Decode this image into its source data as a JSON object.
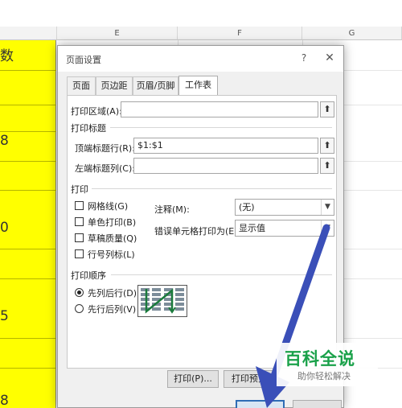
{
  "spreadsheet": {
    "columns": [
      "E",
      "F",
      "G"
    ],
    "yellow_cells": [
      "数",
      "8",
      "0",
      "5",
      "8"
    ]
  },
  "dialog": {
    "title": "页面设置",
    "help": "?",
    "close": "✕",
    "tabs": [
      "页面",
      "页边距",
      "页眉/页脚",
      "工作表"
    ],
    "active_tab": "工作表",
    "print_area": {
      "label": "打印区域(A):",
      "value": ""
    },
    "print_titles": {
      "section": "打印标题",
      "rows_label": "顶端标题行(R):",
      "rows_value": "$1:$1",
      "cols_label": "左端标题列(C):",
      "cols_value": ""
    },
    "print": {
      "section": "打印",
      "gridlines": "网格线(G)",
      "black_white": "单色打印(B)",
      "draft": "草稿质量(Q)",
      "row_col_headings": "行号列标(L)",
      "comments_label": "注释(M):",
      "comments_value": "(无)",
      "errors_label": "错误单元格打印为(E):",
      "errors_value": "显示值"
    },
    "page_order": {
      "section": "打印顺序",
      "down_then_over": "先列后行(D)",
      "over_then_down": "先行后列(V)",
      "selected": "先列后行(D)"
    },
    "buttons": {
      "print": "打印(P)...",
      "preview": "打印预览("
    }
  },
  "watermark": {
    "title": "百科全说",
    "subtitle": "助你轻松解决"
  },
  "colors": {
    "highlight_yellow": "#ffff00",
    "arrow": "#3a4fb8",
    "watermark_green": "#1aa14a"
  }
}
